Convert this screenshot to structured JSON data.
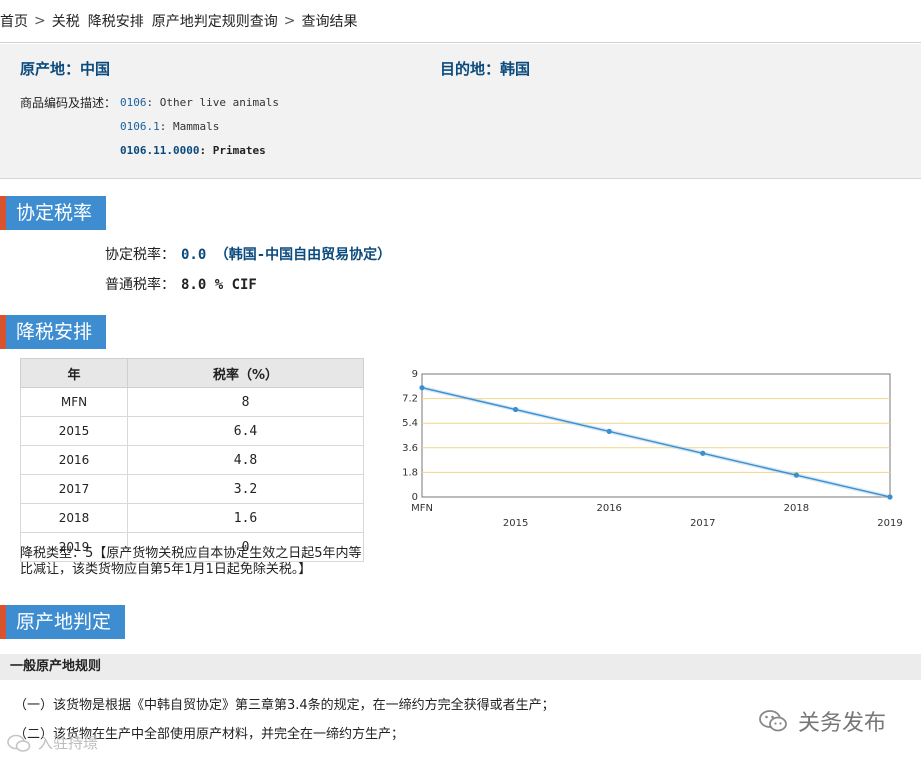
{
  "breadcrumb": {
    "home": "首页",
    "tariff": "关税",
    "tariff_cut": "降税安排",
    "origin_query": "原产地判定规则查询",
    "result": "查询结果"
  },
  "origin": {
    "label": "原产地：",
    "value": "中国"
  },
  "destination": {
    "label": "目的地：",
    "value": "韩国"
  },
  "goods": {
    "label": "商品编码及描述：",
    "items": [
      {
        "code": "0106",
        "desc": ": Other live animals"
      },
      {
        "code": "0106.1",
        "desc": ": Mammals"
      },
      {
        "code": "0106.11.0000",
        "desc": ": Primates"
      }
    ]
  },
  "section_agreed": {
    "title": "协定税率"
  },
  "agreed_rate": {
    "label": "协定税率：",
    "value": "0.0 （韩国-中国自由贸易协定）"
  },
  "general_rate": {
    "label": "普通税率：",
    "value": "8.0 % CIF"
  },
  "section_cut": {
    "title": "降税安排"
  },
  "schedule": {
    "headers": [
      "年",
      "税率（%）"
    ],
    "rows": [
      [
        "MFN",
        "8"
      ],
      [
        "2015",
        "6.4"
      ],
      [
        "2016",
        "4.8"
      ],
      [
        "2017",
        "3.2"
      ],
      [
        "2018",
        "1.6"
      ],
      [
        "2019",
        "0"
      ]
    ]
  },
  "cut_note": "降税类型：5【原产货物关税应自本协定生效之日起5年内等比减让，该类货物应自第5年1月1日起免除关税。】",
  "chart_data": {
    "type": "line",
    "categories": [
      "MFN",
      "2015",
      "2016",
      "2017",
      "2018",
      "2019"
    ],
    "values": [
      8,
      6.4,
      4.8,
      3.2,
      1.6,
      0
    ],
    "yticks": [
      "0",
      "1.8",
      "3.6",
      "5.4",
      "7.2",
      "9"
    ],
    "ylim": [
      0,
      9
    ],
    "grid": true,
    "line_color": "#3a8fd1",
    "grid_color": "#f0d68a"
  },
  "section_origin": {
    "title": "原产地判定"
  },
  "rules": {
    "title": "一般原产地规则",
    "lines": [
      "（一）该货物是根据《中韩自贸协定》第三章第3.4条的规定，在一缔约方完全获得或者生产；",
      "（二）该货物在生产中全部使用原产材料，并完全在一缔约方生产；"
    ]
  },
  "watermark": {
    "right": "关务发布",
    "left": "入驻持璟"
  }
}
